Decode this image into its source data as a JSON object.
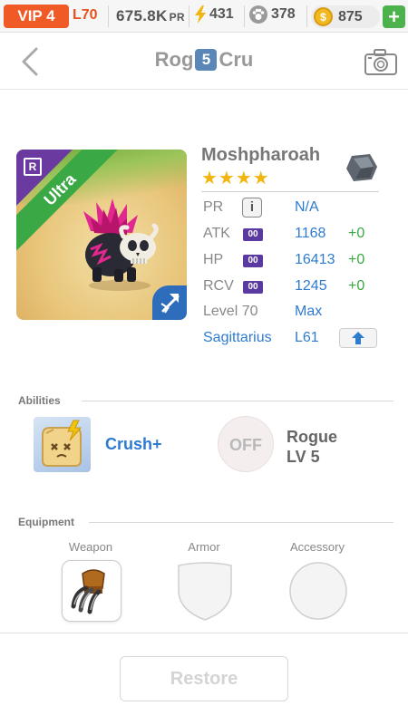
{
  "status_bar": {
    "vip": "VIP 4",
    "level": "L70",
    "pr": "675.8K",
    "pr_unit": "PR",
    "energy": "431",
    "paws": "378",
    "coins": "875",
    "coin_symbol": "$",
    "plus": "+"
  },
  "header": {
    "title_left": "Rog",
    "team_number": "5",
    "title_right": "Cru"
  },
  "monster": {
    "name": "Moshpharoah",
    "stars": "★★★★",
    "rarity_badge": "R",
    "ribbon": "Ultra",
    "stats": [
      {
        "label": "PR",
        "value": "N/A",
        "bonus": ""
      },
      {
        "label": "ATK",
        "value": "1168",
        "bonus": "+0"
      },
      {
        "label": "HP",
        "value": "16413",
        "bonus": "+0"
      },
      {
        "label": "RCV",
        "value": "1245",
        "bonus": "+0"
      },
      {
        "label": "Level 70",
        "value": "Max",
        "bonus": ""
      },
      {
        "label": "Sagittarius",
        "value": "L61",
        "bonus": ""
      }
    ],
    "info_symbol": "i",
    "badge_text": "00"
  },
  "abilities": {
    "section_title": "Abilities",
    "primary": "Crush+",
    "off_label": "OFF",
    "class_name": "Rogue",
    "class_level": "LV 5"
  },
  "equipment": {
    "section_title": "Equipment",
    "slots": [
      "Weapon",
      "Armor",
      "Accessory"
    ]
  },
  "footer": {
    "restore_label": "Restore"
  },
  "colors": {
    "vip": "#f05a26",
    "accent_blue": "#2e7bd0",
    "bonus_green": "#3aa844",
    "ribbon_green": "#3aa844",
    "rarity_purple": "#6a3aa0"
  }
}
